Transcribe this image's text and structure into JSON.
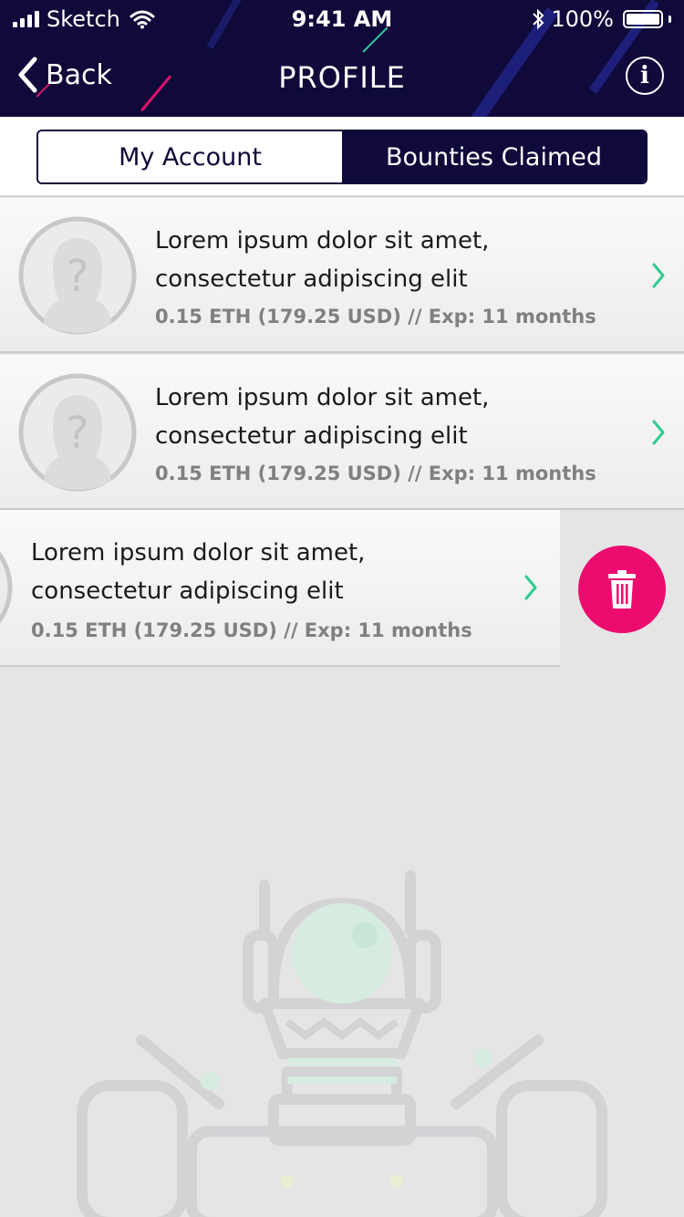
{
  "status_bar": {
    "carrier": "Sketch",
    "time": "9:41 AM",
    "battery": "100%"
  },
  "nav": {
    "back_label": "Back",
    "title": "PROFILE",
    "info_icon": "i"
  },
  "tabs": [
    {
      "label": "My Account",
      "active": true
    },
    {
      "label": "Bounties Claimed",
      "active": false
    }
  ],
  "bounties": [
    {
      "title": "Lorem ipsum dolor sit amet, consectetur adipiscing elit",
      "meta": "0.15 ETH (179.25 USD) // Exp: 11 months"
    },
    {
      "title": "Lorem ipsum dolor sit amet, consectetur adipiscing elit",
      "meta": "0.15 ETH (179.25 USD) // Exp: 11 months"
    },
    {
      "title": "Lorem ipsum dolor sit amet, consectetur adipiscing elit",
      "meta": "0.15 ETH (179.25 USD) // Exp: 11 months"
    }
  ],
  "colors": {
    "header_bg": "#0f0a3a",
    "accent_green": "#2ecc8f",
    "delete_pink": "#ec0c6f"
  },
  "icons": {
    "back": "chevron-left-icon",
    "info": "info-icon",
    "avatar": "unknown-person-icon",
    "row_chevron": "chevron-right-icon",
    "delete": "trash-icon"
  }
}
